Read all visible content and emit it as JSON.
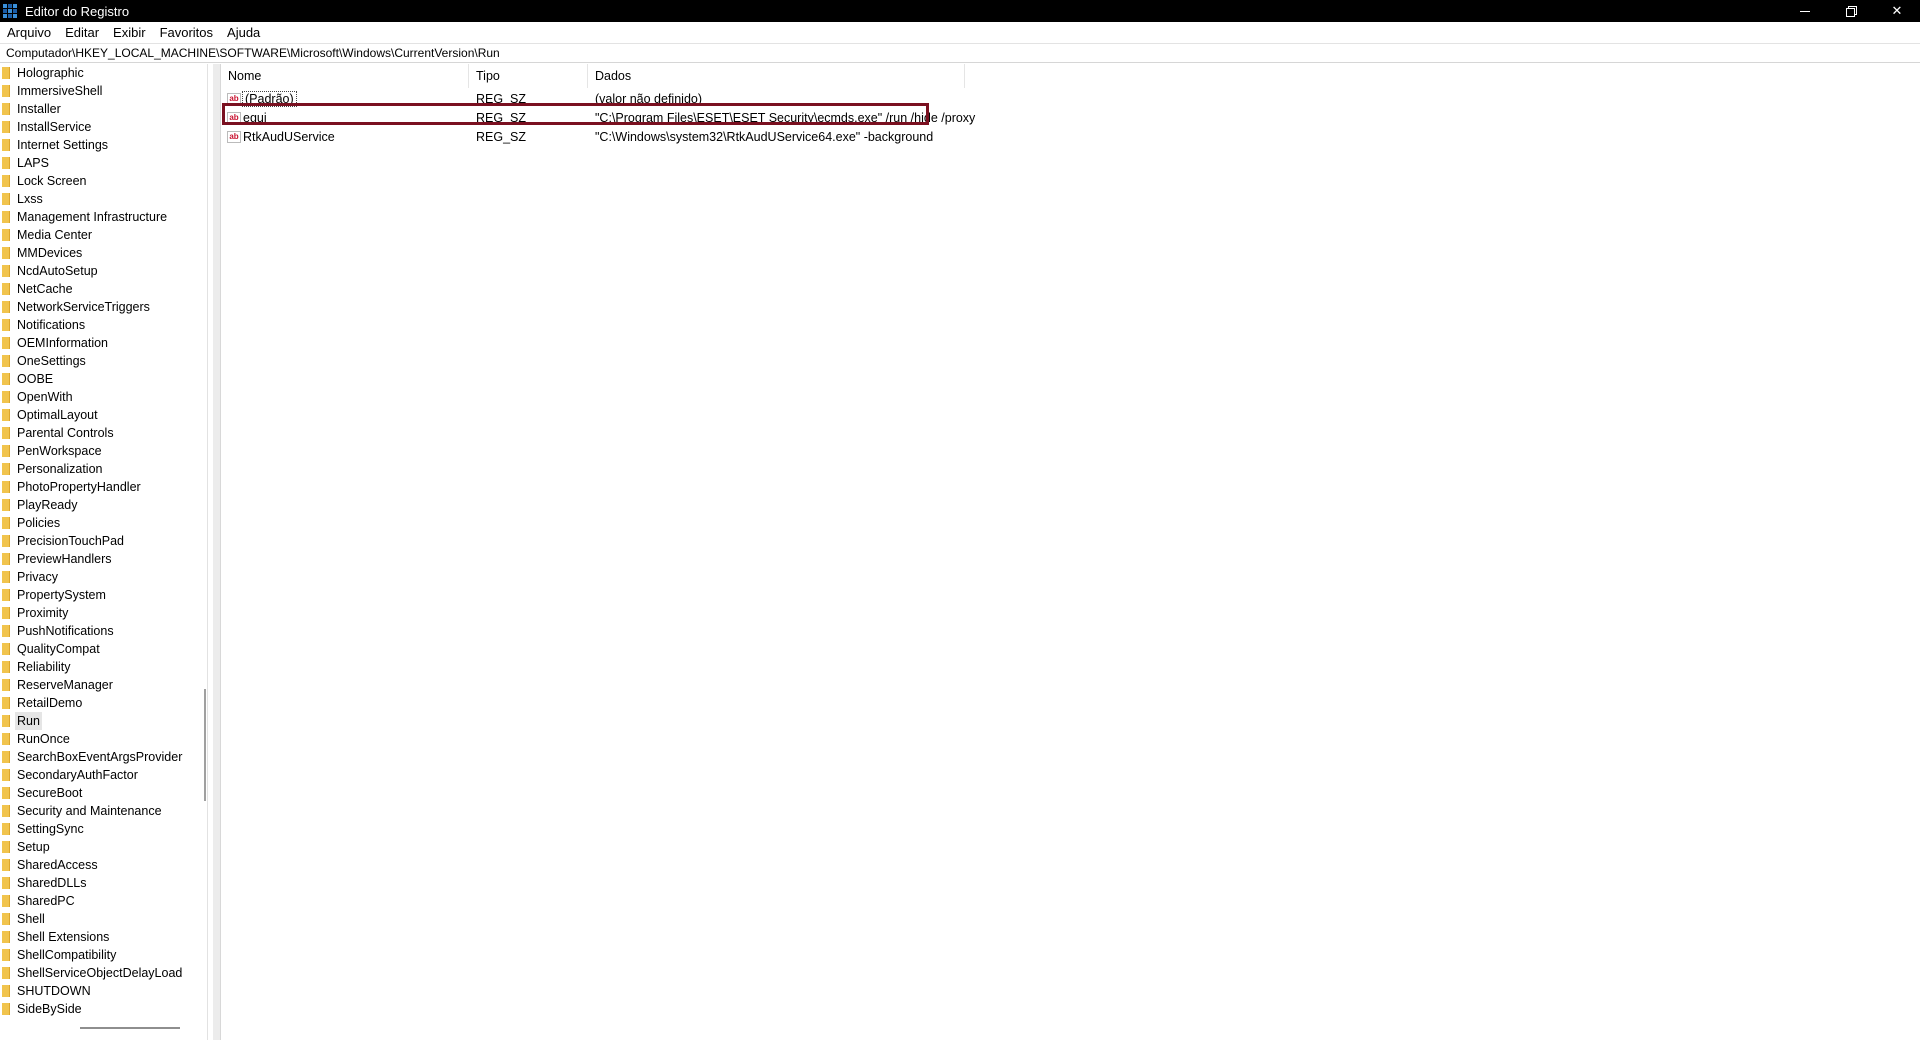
{
  "window": {
    "title": "Editor do Registro",
    "minimize_icon": "minimize-icon",
    "restore_icon": "restore-icon",
    "close_label": "✕"
  },
  "menu": [
    "Arquivo",
    "Editar",
    "Exibir",
    "Favoritos",
    "Ajuda"
  ],
  "address": "Computador\\HKEY_LOCAL_MACHINE\\SOFTWARE\\Microsoft\\Windows\\CurrentVersion\\Run",
  "tree": {
    "selected": "Run",
    "items": [
      "Holographic",
      "ImmersiveShell",
      "Installer",
      "InstallService",
      "Internet Settings",
      "LAPS",
      "Lock Screen",
      "Lxss",
      "Management Infrastructure",
      "Media Center",
      "MMDevices",
      "NcdAutoSetup",
      "NetCache",
      "NetworkServiceTriggers",
      "Notifications",
      "OEMInformation",
      "OneSettings",
      "OOBE",
      "OpenWith",
      "OptimalLayout",
      "Parental Controls",
      "PenWorkspace",
      "Personalization",
      "PhotoPropertyHandler",
      "PlayReady",
      "Policies",
      "PrecisionTouchPad",
      "PreviewHandlers",
      "Privacy",
      "PropertySystem",
      "Proximity",
      "PushNotifications",
      "QualityCompat",
      "Reliability",
      "ReserveManager",
      "RetailDemo",
      "Run",
      "RunOnce",
      "SearchBoxEventArgsProvider",
      "SecondaryAuthFactor",
      "SecureBoot",
      "Security and Maintenance",
      "SettingSync",
      "Setup",
      "SharedAccess",
      "SharedDLLs",
      "SharedPC",
      "Shell",
      "Shell Extensions",
      "ShellCompatibility",
      "ShellServiceObjectDelayLoad",
      "SHUTDOWN",
      "SideBySide"
    ]
  },
  "columns": {
    "name": "Nome",
    "type": "Tipo",
    "data": "Dados"
  },
  "values": [
    {
      "name": "(Padrão)",
      "type": "REG_SZ",
      "data": "(valor não definido)"
    },
    {
      "name": "egui",
      "type": "REG_SZ",
      "data": "\"C:\\Program Files\\ESET\\ESET Security\\ecmds.exe\" /run /hide /proxy"
    },
    {
      "name": "RtkAudUService",
      "type": "REG_SZ",
      "data": "\"C:\\Windows\\system32\\RtkAudUService64.exe\" -background"
    }
  ],
  "value_icon_text": "ab",
  "colors": {
    "highlight": "#7a1020",
    "folder": "#f1c44d"
  }
}
